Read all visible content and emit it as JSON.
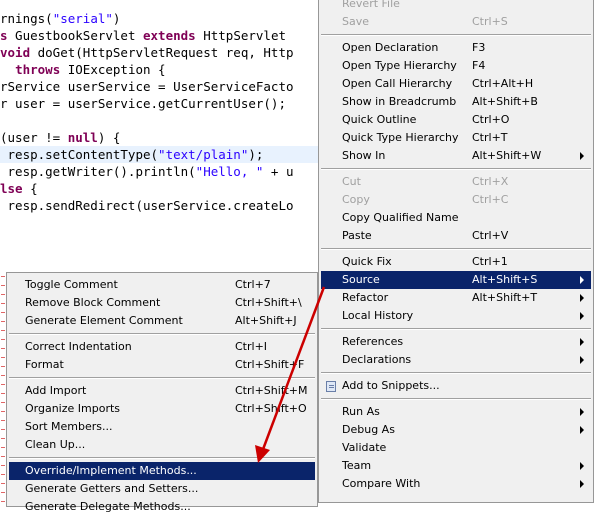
{
  "editor": {
    "lines": [
      {
        "parts": [
          {
            "t": "rnings(",
            "c": ""
          },
          {
            "t": "\"serial\"",
            "c": "str"
          },
          {
            "t": ")",
            "c": ""
          }
        ]
      },
      {
        "parts": [
          {
            "t": "s",
            "c": "kw"
          },
          {
            "t": " GuestbookServlet ",
            "c": ""
          },
          {
            "t": "extends",
            "c": "kw"
          },
          {
            "t": " HttpServlet",
            "c": ""
          }
        ]
      },
      {
        "parts": [
          {
            "t": "void",
            "c": "kw"
          },
          {
            "t": " doGet(HttpServletRequest req, Http",
            "c": ""
          }
        ]
      },
      {
        "parts": [
          {
            "t": "  ",
            "c": ""
          },
          {
            "t": "throws",
            "c": "kw"
          },
          {
            "t": " IOException {",
            "c": ""
          }
        ]
      },
      {
        "parts": [
          {
            "t": "rService userService = UserServiceFacto",
            "c": ""
          }
        ]
      },
      {
        "parts": [
          {
            "t": "r user = userService.getCurrentUser();",
            "c": ""
          }
        ]
      },
      {
        "parts": [
          {
            "t": "",
            "c": ""
          }
        ]
      },
      {
        "parts": [
          {
            "t": "(user != ",
            "c": ""
          },
          {
            "t": "null",
            "c": "kw"
          },
          {
            "t": ") {",
            "c": ""
          }
        ]
      },
      {
        "parts": [
          {
            "t": " resp.setContentType(",
            "c": ""
          },
          {
            "t": "\"text/plain\"",
            "c": "str"
          },
          {
            "t": ");",
            "c": ""
          }
        ]
      },
      {
        "parts": [
          {
            "t": " resp.getWriter().println(",
            "c": ""
          },
          {
            "t": "\"Hello, \"",
            "c": "str"
          },
          {
            "t": " + u",
            "c": ""
          }
        ]
      },
      {
        "parts": [
          {
            "t": "lse",
            "c": "kw"
          },
          {
            "t": " {",
            "c": ""
          }
        ]
      },
      {
        "parts": [
          {
            "t": " resp.sendRedirect(userService.createLo",
            "c": ""
          }
        ]
      }
    ]
  },
  "context_menu": {
    "items": [
      {
        "label": "Revert File",
        "accel": "",
        "disabled": true
      },
      {
        "label": "Save",
        "accel": "Ctrl+S",
        "disabled": true
      },
      {
        "sep": true
      },
      {
        "label": "Open Declaration",
        "accel": "F3"
      },
      {
        "label": "Open Type Hierarchy",
        "accel": "F4"
      },
      {
        "label": "Open Call Hierarchy",
        "accel": "Ctrl+Alt+H"
      },
      {
        "label": "Show in Breadcrumb",
        "accel": "Alt+Shift+B"
      },
      {
        "label": "Quick Outline",
        "accel": "Ctrl+O"
      },
      {
        "label": "Quick Type Hierarchy",
        "accel": "Ctrl+T"
      },
      {
        "label": "Show In",
        "accel": "Alt+Shift+W",
        "submenu": true
      },
      {
        "sep": true
      },
      {
        "label": "Cut",
        "accel": "Ctrl+X",
        "disabled": true
      },
      {
        "label": "Copy",
        "accel": "Ctrl+C",
        "disabled": true
      },
      {
        "label": "Copy Qualified Name",
        "accel": ""
      },
      {
        "label": "Paste",
        "accel": "Ctrl+V"
      },
      {
        "sep": true
      },
      {
        "label": "Quick Fix",
        "accel": "Ctrl+1"
      },
      {
        "label": "Source",
        "accel": "Alt+Shift+S",
        "submenu": true,
        "selected": true
      },
      {
        "label": "Refactor",
        "accel": "Alt+Shift+T",
        "submenu": true
      },
      {
        "label": "Local History",
        "accel": "",
        "submenu": true
      },
      {
        "sep": true
      },
      {
        "label": "References",
        "accel": "",
        "submenu": true
      },
      {
        "label": "Declarations",
        "accel": "",
        "submenu": true
      },
      {
        "sep": true
      },
      {
        "label": "Add to Snippets...",
        "accel": "",
        "icon": "snippet-icon"
      },
      {
        "sep": true
      },
      {
        "label": "Run As",
        "accel": "",
        "submenu": true
      },
      {
        "label": "Debug As",
        "accel": "",
        "submenu": true
      },
      {
        "label": "Validate",
        "accel": ""
      },
      {
        "label": "Team",
        "accel": "",
        "submenu": true
      },
      {
        "label": "Compare With",
        "accel": "",
        "submenu": true
      }
    ]
  },
  "source_submenu": {
    "items": [
      {
        "label": "Toggle Comment",
        "accel": "Ctrl+7"
      },
      {
        "label": "Remove Block Comment",
        "accel": "Ctrl+Shift+\\"
      },
      {
        "label": "Generate Element Comment",
        "accel": "Alt+Shift+J"
      },
      {
        "sep": true
      },
      {
        "label": "Correct Indentation",
        "accel": "Ctrl+I"
      },
      {
        "label": "Format",
        "accel": "Ctrl+Shift+F"
      },
      {
        "sep": true
      },
      {
        "label": "Add Import",
        "accel": "Ctrl+Shift+M"
      },
      {
        "label": "Organize Imports",
        "accel": "Ctrl+Shift+O"
      },
      {
        "label": "Sort Members...",
        "accel": ""
      },
      {
        "label": "Clean Up...",
        "accel": ""
      },
      {
        "sep": true
      },
      {
        "label": "Override/Implement Methods...",
        "accel": "",
        "selected": true
      },
      {
        "label": "Generate Getters and Setters...",
        "accel": ""
      },
      {
        "label": "Generate Delegate Methods...",
        "accel": ""
      }
    ]
  },
  "colors": {
    "selection": "#0a246a",
    "annotation_arrow": "#cc0000"
  }
}
